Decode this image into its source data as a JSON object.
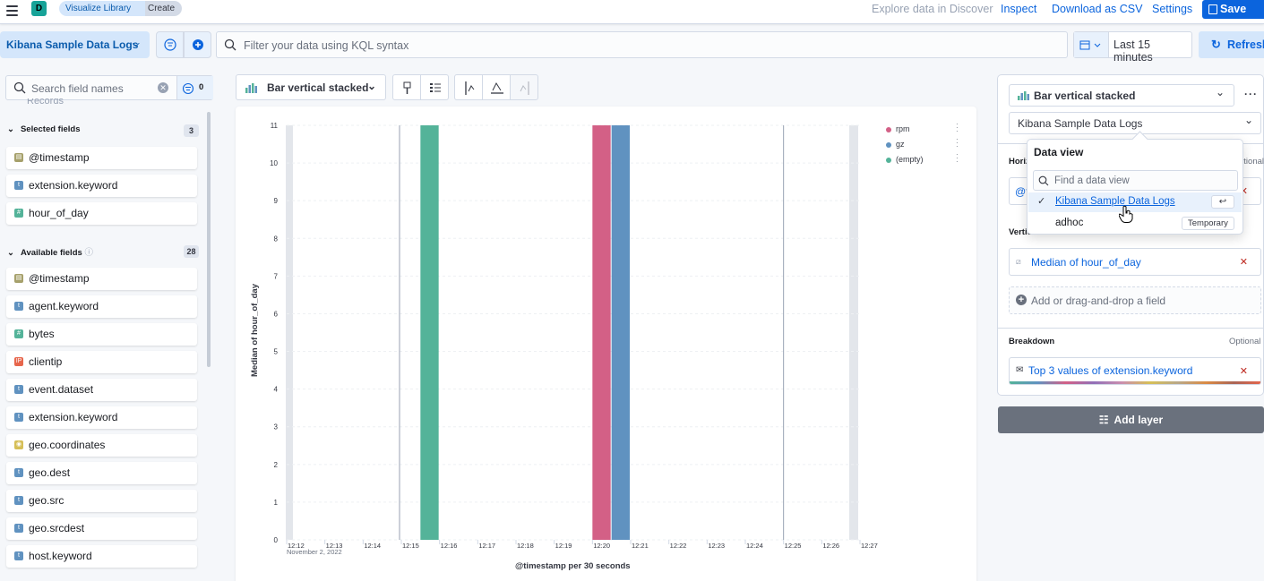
{
  "header": {
    "space_letter": "D",
    "breadcrumbs": [
      "Visualize Library",
      "Create"
    ],
    "links": [
      "Explore data in Discover",
      "Inspect",
      "Download as CSV",
      "Settings"
    ],
    "save_label": "Save"
  },
  "query": {
    "data_view": "Kibana Sample Data Logs",
    "kql_placeholder": "Filter your data using KQL syntax",
    "date_label": "Last 15 minutes",
    "refresh_label": "Refresh"
  },
  "fields": {
    "search_placeholder": "Search field names",
    "filter_count": "0",
    "records_partial": "Records",
    "selected_title": "Selected fields",
    "selected_count": "3",
    "selected": [
      {
        "name": "@timestamp",
        "type": "date"
      },
      {
        "name": "extension.keyword",
        "type": "string"
      },
      {
        "name": "hour_of_day",
        "type": "number"
      }
    ],
    "available_title": "Available fields",
    "available_count": "28",
    "available": [
      {
        "name": "@timestamp",
        "type": "date"
      },
      {
        "name": "agent.keyword",
        "type": "string"
      },
      {
        "name": "bytes",
        "type": "number"
      },
      {
        "name": "clientip",
        "type": "ip"
      },
      {
        "name": "event.dataset",
        "type": "string"
      },
      {
        "name": "extension.keyword",
        "type": "string"
      },
      {
        "name": "geo.coordinates",
        "type": "geo"
      },
      {
        "name": "geo.dest",
        "type": "string"
      },
      {
        "name": "geo.src",
        "type": "string"
      },
      {
        "name": "geo.srcdest",
        "type": "string"
      },
      {
        "name": "host.keyword",
        "type": "string"
      }
    ]
  },
  "workspace": {
    "chart_type": "Bar vertical stacked"
  },
  "chart_data": {
    "type": "bar",
    "stacked": true,
    "ylabel": "Median of hour_of_day",
    "xlabel": "@timestamp per 30 seconds",
    "ylim": [
      0,
      11
    ],
    "y_ticks": [
      "0",
      "1",
      "2",
      "3",
      "4",
      "5",
      "6",
      "7",
      "8",
      "9",
      "10",
      "11"
    ],
    "x_ticks": [
      "12:12",
      "12:13",
      "12:14",
      "12:15",
      "12:16",
      "12:17",
      "12:18",
      "12:19",
      "12:20",
      "12:21",
      "12:22",
      "12:23",
      "12:24",
      "12:25",
      "12:26",
      "12:27"
    ],
    "x_date_label": "November 2, 2022",
    "series": [
      {
        "name": "rpm",
        "color": "#d36086",
        "points": [
          {
            "x": "12:20:00",
            "y": 11
          }
        ]
      },
      {
        "name": "gz",
        "color": "#6092c0",
        "points": [
          {
            "x": "12:20:30",
            "y": 11
          }
        ]
      },
      {
        "name": "(empty)",
        "color": "#54b399",
        "points": [
          {
            "x": "12:15:30",
            "y": 11
          }
        ]
      }
    ]
  },
  "config": {
    "chart_type": "Bar vertical stacked",
    "data_view": "Kibana Sample Data Logs",
    "horiz_partial": "Horiz",
    "optional": "Optional",
    "ts_partial": "@t",
    "vertical_partial": "Vertical axis",
    "vertical_value": "Median of hour_of_day",
    "add_field": "Add or drag-and-drop a field",
    "breakdown_title": "Breakdown",
    "breakdown_value": "Top 3 values of extension.keyword",
    "add_layer": "Add layer"
  },
  "popover": {
    "title": "Data view",
    "search_placeholder": "Find a data view",
    "items": [
      {
        "label": "Kibana Sample Data Logs",
        "checked": true
      },
      {
        "label": "adhoc",
        "badge": "Temporary"
      }
    ]
  }
}
